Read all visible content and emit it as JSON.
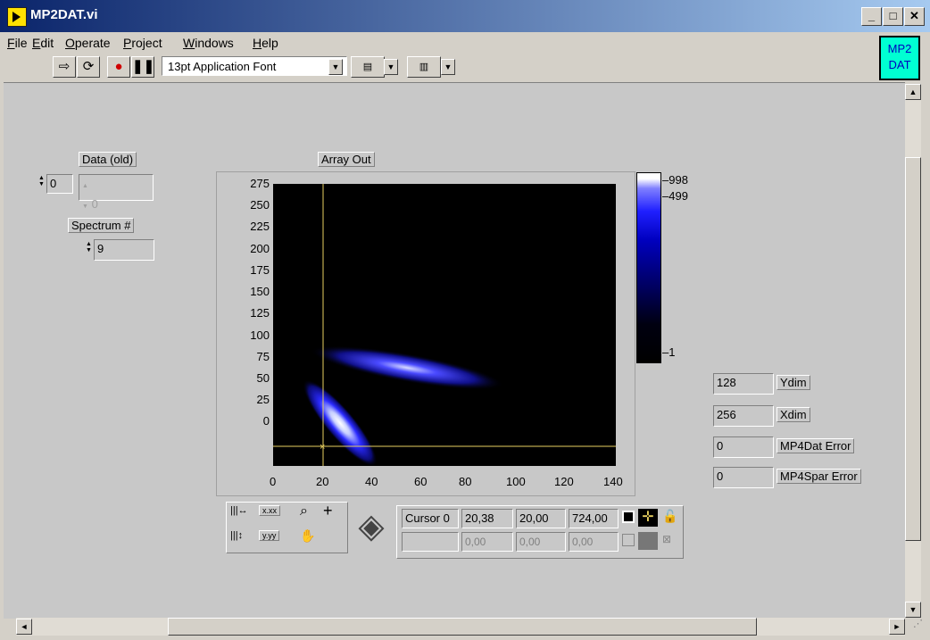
{
  "window": {
    "title": "MP2DAT.vi"
  },
  "menu": [
    "File",
    "Edit",
    "Operate",
    "Project",
    "Windows",
    "Help"
  ],
  "toolbar": {
    "font": "13pt Application Font"
  },
  "vi_icon": {
    "line1": "MP2",
    "line2": "DAT"
  },
  "data_old": {
    "label": "Data (old)",
    "index": "0",
    "value": "0"
  },
  "spectrum": {
    "label": "Spectrum #",
    "value": "9"
  },
  "array_out": {
    "label": "Array Out",
    "y_ticks": [
      "275",
      "250",
      "225",
      "200",
      "175",
      "150",
      "125",
      "100",
      "75",
      "50",
      "25",
      "0"
    ],
    "x_ticks": [
      "0",
      "20",
      "40",
      "60",
      "80",
      "100",
      "120",
      "140"
    ],
    "scale_ticks": [
      "998",
      "499",
      "1"
    ]
  },
  "cursor": {
    "name": "Cursor 0",
    "x": "20,38",
    "y": "20,00",
    "z": "724,00",
    "dim_x": "0,00",
    "dim_y": "0,00",
    "dim_z": "0,00"
  },
  "indicators": [
    {
      "value": "128",
      "label": "Ydim"
    },
    {
      "value": "256",
      "label": "Xdim"
    },
    {
      "value": "0",
      "label": "MP4Dat Error"
    },
    {
      "value": "0",
      "label": "MP4Spar Error"
    }
  ],
  "palette": {
    "zoom_x": "x.xx",
    "zoom_y": "y.yy"
  }
}
